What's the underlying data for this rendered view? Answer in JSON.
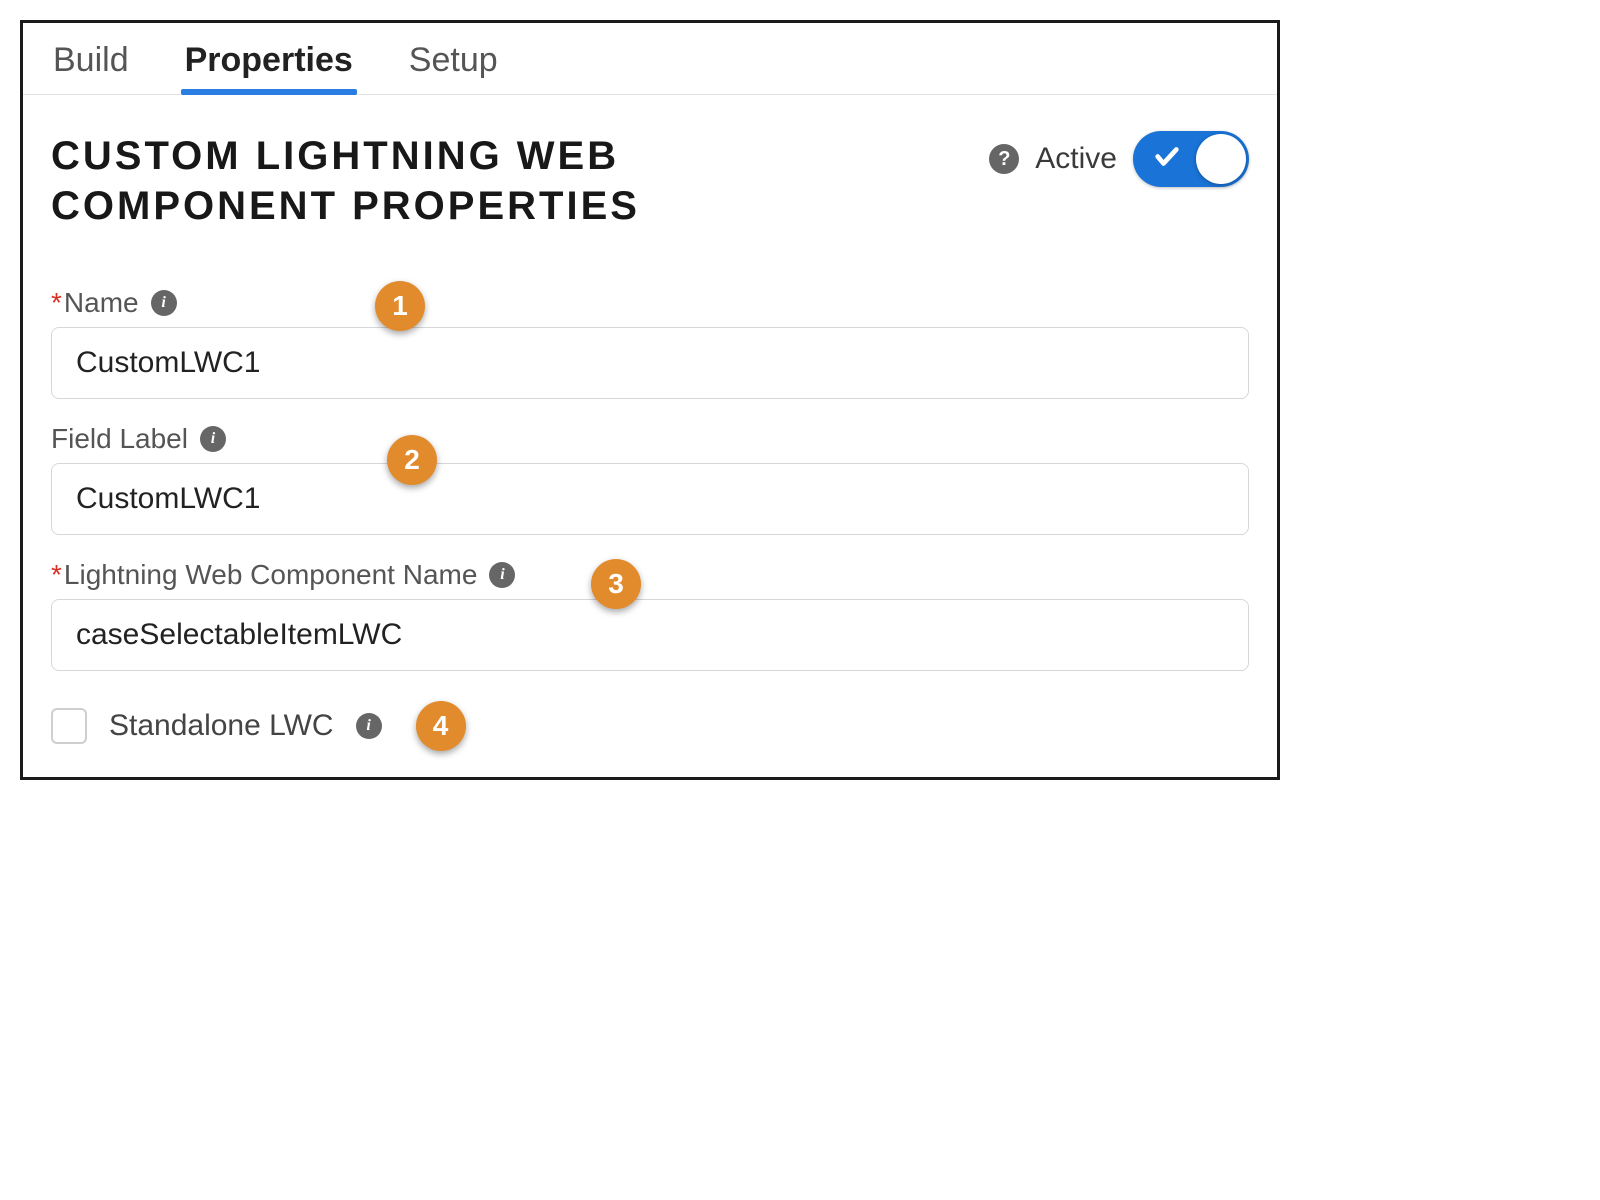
{
  "tabs": {
    "build": "Build",
    "properties": "Properties",
    "setup": "Setup"
  },
  "header": {
    "title": "CUSTOM LIGHTNING WEB COMPONENT PROPERTIES",
    "active_label": "Active"
  },
  "form": {
    "name": {
      "label": "Name",
      "value": "CustomLWC1"
    },
    "field_label": {
      "label": "Field Label",
      "value": "CustomLWC1"
    },
    "lwc_name": {
      "label": "Lightning Web Component Name",
      "value": "caseSelectableItemLWC"
    },
    "standalone": {
      "label": "Standalone LWC"
    }
  },
  "annotations": {
    "b1": "1",
    "b2": "2",
    "b3": "3",
    "b4": "4"
  }
}
